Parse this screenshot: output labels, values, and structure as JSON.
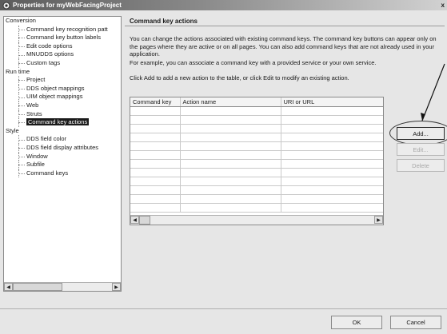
{
  "window": {
    "title": "Properties for myWebFacingProject",
    "close_glyph": "x"
  },
  "tree": {
    "nodes": [
      {
        "label": "Conversion",
        "level": 0
      },
      {
        "label": "Command key recognition patt",
        "level": 1
      },
      {
        "label": "Command key button labels",
        "level": 1
      },
      {
        "label": "Edit code options",
        "level": 1
      },
      {
        "label": "MNUDDS options",
        "level": 1
      },
      {
        "label": "Custom tags",
        "level": 1
      },
      {
        "label": "Run time",
        "level": 0
      },
      {
        "label": "Project",
        "level": 1
      },
      {
        "label": "DDS object mappings",
        "level": 1
      },
      {
        "label": "UIM object mappings",
        "level": 1
      },
      {
        "label": "Web",
        "level": 1
      },
      {
        "label": "Struts",
        "level": 1
      },
      {
        "label": "Command key actions",
        "level": 1,
        "selected": true
      },
      {
        "label": "Style",
        "level": 0
      },
      {
        "label": "DDS field color",
        "level": 1
      },
      {
        "label": "DDS field display attributes",
        "level": 1
      },
      {
        "label": "Window",
        "level": 1
      },
      {
        "label": "Subfile",
        "level": 1
      },
      {
        "label": "Command keys",
        "level": 1
      }
    ]
  },
  "panel": {
    "title": "Command key actions",
    "description1": "You can change the actions associated with existing command keys. The command key buttons can appear only on the pages where they are active or on all pages. You can also add command keys that are not already used in your application.",
    "description2": "For example, you can associate a command key with a provided service or your own service.",
    "description3": "Click Add to add a new action to the table, or click Edit to modify an existing action.",
    "table": {
      "columns": [
        "Command key",
        "Action name",
        "URI or URL"
      ],
      "empty_rows": 12
    },
    "buttons": {
      "add": "Add...",
      "edit": "Edit...",
      "delete": "Delete"
    }
  },
  "footer": {
    "ok": "OK",
    "cancel": "Cancel"
  },
  "icons": {
    "scroll_left": "left-arrow-icon",
    "scroll_right": "right-arrow-icon",
    "window_icon": "properties-icon"
  },
  "colors": {
    "selection": "#1a1a1a",
    "titlebar_start": "#5c5c5c",
    "titlebar_end": "#d2d2d2"
  }
}
